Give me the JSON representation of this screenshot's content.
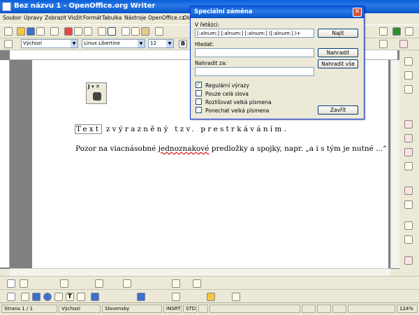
{
  "window": {
    "title": "Bez názvu 1 - OpenOffice.org Writer"
  },
  "menu": {
    "items": [
      "Soubor",
      "Úpravy",
      "Zobrazit",
      "Vložit",
      "Formát",
      "Tabulka",
      "Nástroje",
      "OpenOffice.cz",
      "Ok"
    ]
  },
  "formatting": {
    "style": "Výchozí",
    "font": "Linux Libertine",
    "size": "12"
  },
  "document": {
    "line1_selected": "Text",
    "line1_rest": "zvýrazněný tzv. prestrkáváním.",
    "line2_before": "Pozor na viacnásobné ",
    "line2_wavy": "jednoznakové",
    "line2_after": " predložky a spojky, napr. „a i s tým je nutné ...“"
  },
  "dialog": {
    "title": "Speciální záměna",
    "in_string_label": "V řetězci:",
    "in_string_value": "[:alnum:] [:alnum:] [:alnum:] ([:alnum:] )+",
    "search_label": "Hledat:",
    "search_value": "",
    "replace_label": "Nahradit za:",
    "replace_value": "",
    "btn_find": "Najít",
    "btn_replace": "Nahradit",
    "btn_replace_all": "Nahradit vše",
    "btn_close": "Zavřít",
    "options": [
      {
        "label": "Regulární výrazy",
        "checked": true
      },
      {
        "label": "Pouze celá slova",
        "checked": false
      },
      {
        "label": "Rozlišovat velká písmena",
        "checked": false
      },
      {
        "label": "Ponechat velká písmena",
        "checked": false
      }
    ]
  },
  "mini_toolbar": {
    "label": "J ▾ ✕"
  },
  "status": {
    "page": "Strana 1 / 1",
    "style": "Výchozí",
    "language": "Slovensky",
    "insert": "INSRT",
    "std": "STD",
    "zoom": "124%"
  }
}
